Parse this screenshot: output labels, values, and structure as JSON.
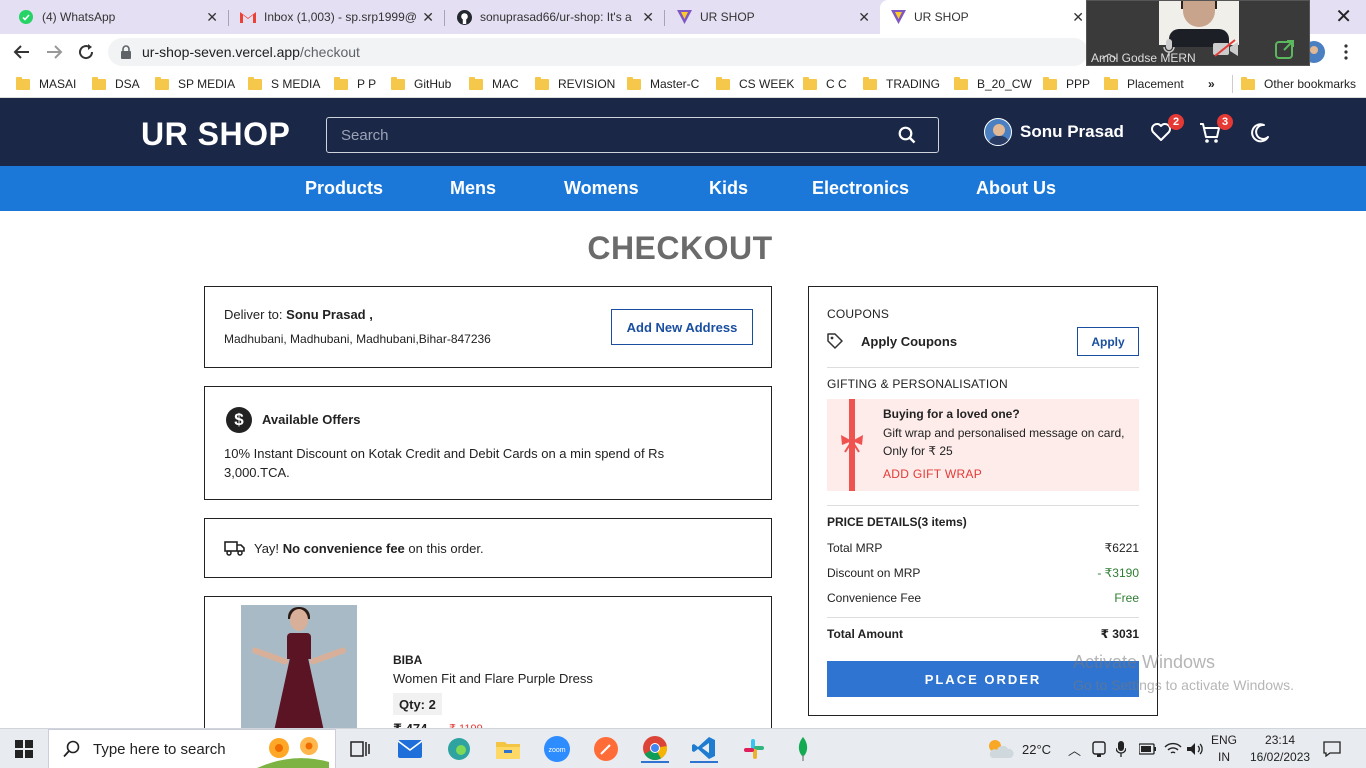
{
  "browser": {
    "tabs": [
      {
        "title": "(4) WhatsApp",
        "icon": "whatsapp-icon"
      },
      {
        "title": "Inbox (1,003) - sp.srp1999@g",
        "icon": "gmail-icon"
      },
      {
        "title": "sonuprasad66/ur-shop: It's a",
        "icon": "github-icon"
      },
      {
        "title": "UR SHOP",
        "icon": "vite-icon"
      },
      {
        "title": "UR SHOP",
        "icon": "vite-icon"
      }
    ],
    "url_host": "ur-shop-seven.vercel.app",
    "url_path": "/checkout",
    "bookmarks": [
      "MASAI",
      "DSA",
      "SP MEDIA",
      "S MEDIA",
      "P P",
      "GitHub",
      "MAC",
      "REVISION",
      "Master-C",
      "CS WEEK",
      "C C",
      "TRADING",
      "B_20_CW",
      "PPP",
      "Placement"
    ],
    "bookmarks_more": "»",
    "other_bookmarks": "Other bookmarks"
  },
  "video_call": {
    "participant": "Amol Godse MERN"
  },
  "header": {
    "logo": "UR SHOP",
    "search_placeholder": "Search",
    "username": "Sonu Prasad",
    "wishlist_count": "2",
    "cart_count": "3"
  },
  "nav": {
    "items": [
      "Products",
      "Mens",
      "Womens",
      "Kids",
      "Electronics",
      "About Us"
    ]
  },
  "checkout": {
    "title": "CHECKOUT",
    "deliver_label": "Deliver to:",
    "deliver_name": "Sonu Prasad ,",
    "deliver_address": "Madhubani, Madhubani, Madhubani,Bihar-847236",
    "add_address_label": "Add New Address",
    "offers_title": "Available Offers",
    "offers_text": "10% Instant Discount on Kotak Credit and Debit Cards on a min spend of Rs 3,000.TCA.",
    "fee_prefix": "Yay!",
    "fee_bold": "No convenience fee",
    "fee_suffix": "on this order.",
    "item": {
      "brand": "BIBA",
      "name": "Women Fit and Flare Purple Dress",
      "qty": "Qty: 2",
      "price": "₹ 474",
      "mrp": "₹ 1199"
    }
  },
  "summary": {
    "coupons_label": "COUPONS",
    "apply_coupons": "Apply Coupons",
    "apply_button": "Apply",
    "gifting_label": "GIFTING & PERSONALISATION",
    "gift_title": "Buying for a loved one?",
    "gift_text": "Gift wrap and personalised message on card, Only for ₹ 25",
    "gift_link": "ADD GIFT WRAP",
    "price_details": "PRICE DETAILS(3 items)",
    "rows": [
      {
        "label": "Total MRP",
        "value": "₹6221"
      },
      {
        "label": "Discount on MRP",
        "value": "- ₹3190"
      },
      {
        "label": "Convenience Fee",
        "value": "Free"
      }
    ],
    "total_label": "Total Amount",
    "total_value": "₹ 3031",
    "place_order": "PLACE ORDER"
  },
  "windows": {
    "activate_title": "Activate Windows",
    "activate_sub": "Go to Settings to activate Windows.",
    "search_placeholder": "Type here to search",
    "weather": "22°C",
    "lang": "ENG",
    "region": "IN",
    "time": "23:14",
    "date": "16/02/2023"
  },
  "colors": {
    "header_bg": "#1a2747",
    "nav_bg": "#1c78d8",
    "place_order_bg": "#2f74d0",
    "badge": "#e53935",
    "discount_green": "#2e7d32",
    "gift_pink": "#fdecea"
  }
}
